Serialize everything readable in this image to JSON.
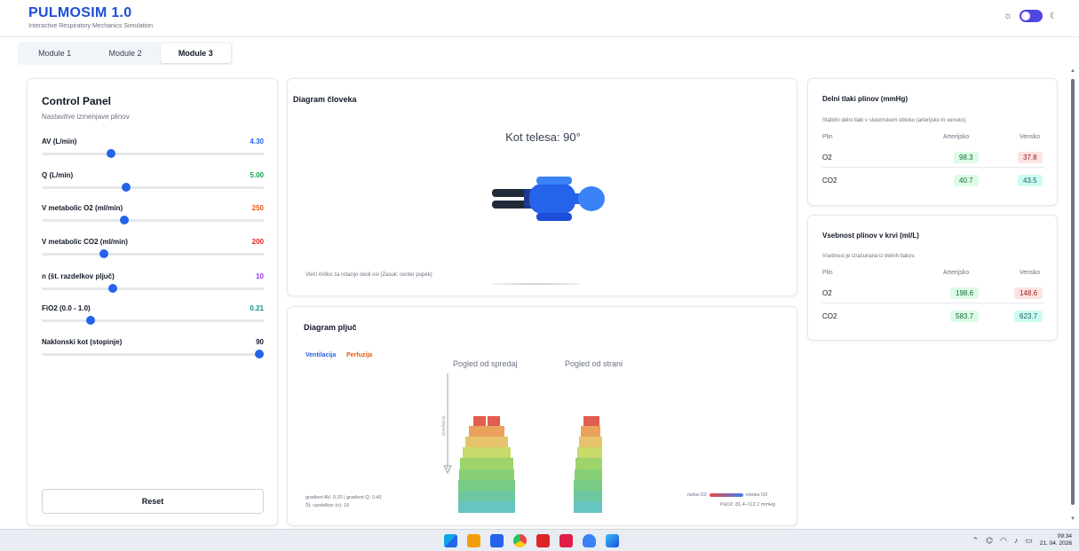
{
  "app": {
    "title": "PULMOSIM 1.0",
    "subtitle": "Interactive Respiratory Mechanics Simulation",
    "theme_dark_enabled": true
  },
  "tabs": [
    {
      "label": "Module 1",
      "active": false
    },
    {
      "label": "Module 2",
      "active": false
    },
    {
      "label": "Module 3",
      "active": true
    }
  ],
  "control_panel": {
    "title": "Control Panel",
    "subtitle": "Nastavitve izmenjave plinov",
    "sliders": [
      {
        "label": "AV (L/min)",
        "value": "4.30",
        "color": "#2563eb",
        "fill_fraction": 0.31
      },
      {
        "label": "Q (L/min)",
        "value": "5.00",
        "color": "#16a34a",
        "fill_fraction": 0.38
      },
      {
        "label": "V metabolic O2 (ml/min)",
        "value": "250",
        "color": "#ea580c",
        "fill_fraction": 0.37
      },
      {
        "label": "V metabolic CO2 (ml/min)",
        "value": "200",
        "color": "#dc2626",
        "fill_fraction": 0.28
      },
      {
        "label": "n (št. razdelkov pljuč)",
        "value": "10",
        "color": "#9333ea",
        "fill_fraction": 0.32
      },
      {
        "label": "FiO2 (0.0 - 1.0)",
        "value": "0.21",
        "color": "#0d9488",
        "fill_fraction": 0.22
      },
      {
        "label": "Naklonski kot (stopinje)",
        "value": "90",
        "color": "#111827",
        "fill_fraction": 0.98
      }
    ],
    "reset_label": "Reset"
  },
  "human_diagram": {
    "title": "Diagram človeka",
    "angle_label": "Kot telesa: 90°",
    "hint": "Vleči miško za rotacijo okoli osi (Zasuk: center popek)"
  },
  "lung_diagram": {
    "title": "Diagram pljuč",
    "legend_ventilation": "Ventilacija",
    "legend_perfusion": "Perfuzija",
    "view_front": "Pogled od spredaj",
    "view_side": "Pogled od strani",
    "gravity_label": "gravitacija",
    "gradient_text": "gradient AV: 0.20 | gradient Q: 0.40",
    "segments_text": "Št. razdelkov (n): 10",
    "o2_low": "nizka O2",
    "o2_high": "visoka O2",
    "pao2_range": "PaO2: 81.4–112.2 mmHg"
  },
  "partial_pressures": {
    "title": "Delni tlaki plinov (mmHg)",
    "description": "Stabilni delni tlaki v sistemskem obtoku (arterijsko in vensko).",
    "headers": [
      "Plin",
      "Arterijsko",
      "Vensko"
    ],
    "rows": [
      {
        "gas": "O2",
        "arterial": "98.3",
        "venous": "37.8"
      },
      {
        "gas": "CO2",
        "arterial": "40.7",
        "venous": "43.5"
      }
    ]
  },
  "blood_content": {
    "title": "Vsebnost plinov v krvi (ml/L)",
    "description": "Vsebnost je izračunana iz delnih tlakov.",
    "headers": [
      "Plin",
      "Arterijsko",
      "Vensko"
    ],
    "rows": [
      {
        "gas": "O2",
        "arterial": "198.6",
        "venous": "148.6"
      },
      {
        "gas": "CO2",
        "arterial": "583.7",
        "venous": "623.7"
      }
    ]
  },
  "taskbar": {
    "time": "09:34",
    "date": "21. 04. 2026",
    "apps": [
      "windows-start-icon",
      "file-explorer-icon",
      "word-icon",
      "chrome-icon",
      "powerpoint-icon",
      "calendar-app-icon",
      "onedrive-icon",
      "photos-icon"
    ]
  }
}
